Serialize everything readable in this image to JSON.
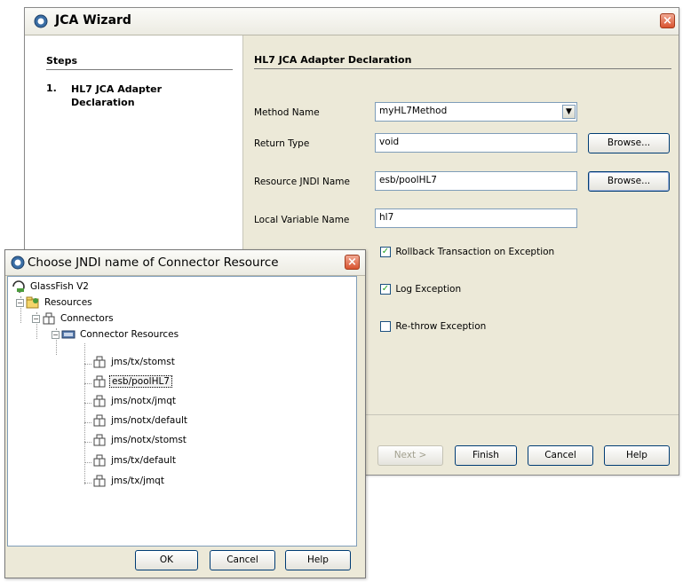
{
  "wizard": {
    "title": "JCA Wizard",
    "steps_heading": "Steps",
    "steps": [
      {
        "number": "1.",
        "label": "HL7 JCA Adapter Declaration"
      }
    ],
    "panel_heading": "HL7 JCA Adapter Declaration",
    "fields": {
      "method_name": {
        "label": "Method Name",
        "value": "myHL7Method"
      },
      "return_type": {
        "label": "Return Type",
        "value": "void"
      },
      "resource_jndi": {
        "label": "Resource JNDI Name",
        "value": "esb/poolHL7"
      },
      "local_var": {
        "label": "Local Variable Name",
        "value": "hl7"
      }
    },
    "browse_label": "Browse...",
    "checkboxes": [
      {
        "label": "Rollback Transaction on Exception",
        "checked": true
      },
      {
        "label": "Log Exception",
        "checked": true
      },
      {
        "label": "Re-throw Exception",
        "checked": false
      }
    ],
    "buttons": {
      "next": "Next >",
      "finish": "Finish",
      "cancel": "Cancel",
      "help": "Help"
    }
  },
  "dialog": {
    "title": "Choose JNDI name of Connector Resource",
    "tree": {
      "root": "GlassFish V2",
      "resources": "Resources",
      "connectors": "Connectors",
      "connector_resources": "Connector Resources",
      "items": [
        "jms/tx/stomst",
        "esb/poolHL7",
        "jms/notx/jmqt",
        "jms/notx/default",
        "jms/notx/stomst",
        "jms/tx/default",
        "jms/tx/jmqt"
      ],
      "selected": "esb/poolHL7"
    },
    "buttons": {
      "ok": "OK",
      "cancel": "Cancel",
      "help": "Help"
    }
  },
  "colors": {
    "window_bg": "#ece9d8",
    "close_button": "#d9532f",
    "field_border": "#7f9db9",
    "button_border": "#003c74"
  },
  "icons": {
    "app": "coffee-cup-icon",
    "close": "close-x-icon",
    "server": "server-icon",
    "folder": "resources-folder-icon",
    "connector": "connector-icon"
  }
}
